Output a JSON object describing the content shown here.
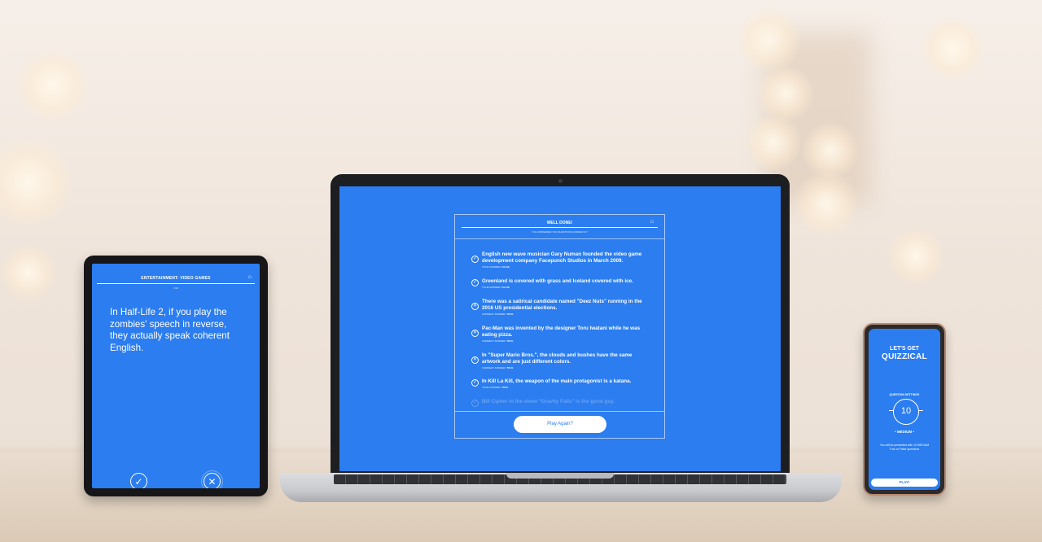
{
  "tablet": {
    "header_title": "ENTERTAINMENT: VIDEO GAMES",
    "home_icon": "home-icon",
    "progress": "1/10",
    "question": "In Half-Life 2, if you play the zombies' speech in reverse, they actually speak coherent English.",
    "true_icon": "check-icon",
    "false_icon": "x-icon"
  },
  "laptop": {
    "title": "WELL DONE!",
    "subtitle": "YOU ANSWERED 7/10 QUESTIONS CORRECTLY",
    "home_icon": "home-icon",
    "results": [
      {
        "question": "English new wave musician Gary Numan founded the video game development company Facepunch Studios in March 2009.",
        "answer_label": "YOUR ANSWER:",
        "answer": "FALSE",
        "status": "correct"
      },
      {
        "question": "Greenland is covered with grass and Iceland covered with ice.",
        "answer_label": "YOUR ANSWER:",
        "answer": "FALSE",
        "status": "correct"
      },
      {
        "question": "There was a satirical candidate named \"Deez Nuts\" running in the 2016 US presidential elections.",
        "answer_label": "CORRECT ANSWER:",
        "answer": "TRUE",
        "status": "wrong"
      },
      {
        "question": "Pac-Man was invented by the designer Toru Iwatani while he was eating pizza.",
        "answer_label": "CORRECT ANSWER:",
        "answer": "TRUE",
        "status": "wrong"
      },
      {
        "question": "In \"Super Mario Bros.\", the clouds and bushes have the same artwork and are just different colors.",
        "answer_label": "CORRECT ANSWER:",
        "answer": "TRUE",
        "status": "wrong"
      },
      {
        "question": "In Kill La Kill, the weapon of the main protagonist is a katana.",
        "answer_label": "YOUR ANSWER:",
        "answer": "TRUE",
        "status": "correct"
      },
      {
        "question": "Bill Cipher in the show \"Gravity Falls\" is the good guy.",
        "answer_label": "",
        "answer": "",
        "status": "correct"
      }
    ],
    "play_again": "Play Again?"
  },
  "phone": {
    "title_line1": "LET'S GET",
    "title_line2": "QUIZZICAL",
    "settings_label": "QUESTION SETTINGS",
    "question_count": "10",
    "difficulty": "• MEDIUM •",
    "description": "You will be presented with 10 MEDIUM True or False questions",
    "play_label": "PLAY!"
  },
  "colors": {
    "accent": "#2b7df0",
    "white": "#ffffff"
  }
}
